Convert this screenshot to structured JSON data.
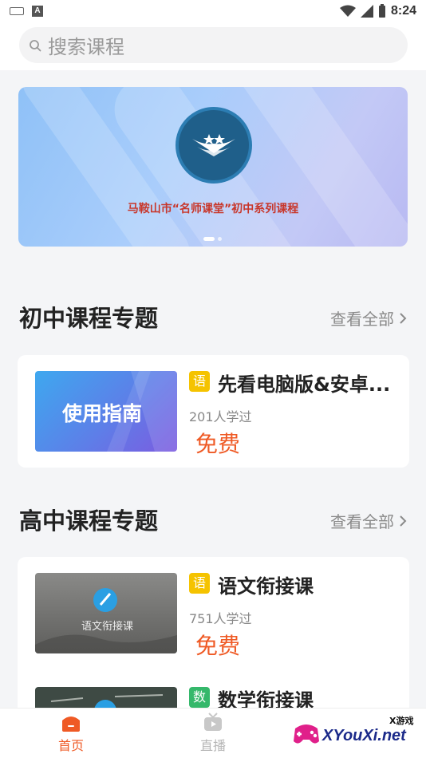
{
  "status": {
    "time": "8:24"
  },
  "search": {
    "placeholder": "搜索课程"
  },
  "banner": {
    "title": "马鞍山市“名师课堂”初中系列课程"
  },
  "sections": [
    {
      "title": "初中课程专题",
      "see_all": "查看全部",
      "courses": [
        {
          "subject": "语",
          "subject_color": "#f5c300",
          "title": "先看电脑版&安卓...",
          "learners": "201人学过",
          "price": "免费",
          "thumb_text": "使用指南"
        }
      ]
    },
    {
      "title": "高中课程专题",
      "see_all": "查看全部",
      "courses": [
        {
          "subject": "语",
          "subject_color": "#f5c300",
          "title": "语文衔接课",
          "learners": "751人学过",
          "price": "免费",
          "thumb_text": "语文衔接课"
        },
        {
          "subject": "数",
          "subject_color": "#35b86b",
          "title": "数学衔接课"
        }
      ]
    }
  ],
  "tabs": [
    {
      "label": "首页",
      "active": true
    },
    {
      "label": "直播",
      "active": false
    }
  ],
  "watermark": {
    "line1": "X游戏",
    "line2": "XYouXi.net"
  },
  "colors": {
    "accent": "#ef5a25",
    "tab_active": "#ef5a25",
    "tab_inactive": "#b5b5b5"
  }
}
